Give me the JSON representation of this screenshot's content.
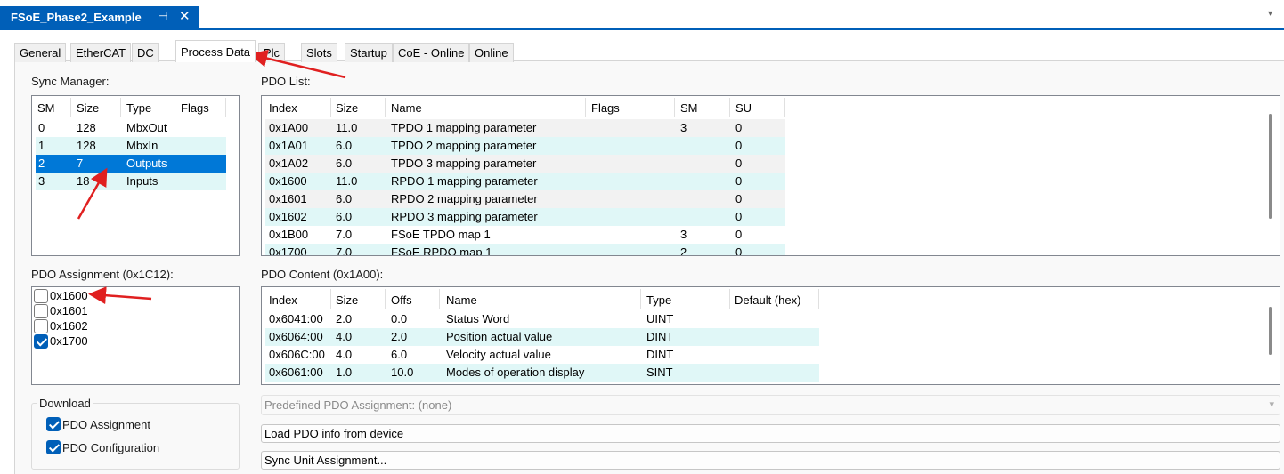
{
  "document_tab": {
    "title": "FSoE_Phase2_Example",
    "pin_glyph": "⊣",
    "close_glyph": "✕"
  },
  "tabs": [
    "General",
    "EtherCAT",
    "DC",
    "Process Data",
    "Plc",
    "Slots",
    "Startup",
    "CoE - Online",
    "Online"
  ],
  "active_tab": "Process Data",
  "sync_manager": {
    "label": "Sync Manager:",
    "columns": [
      "SM",
      "Size",
      "Type",
      "Flags"
    ],
    "rows": [
      {
        "sm": "0",
        "size": "128",
        "type": "MbxOut",
        "flags": ""
      },
      {
        "sm": "1",
        "size": "128",
        "type": "MbxIn",
        "flags": ""
      },
      {
        "sm": "2",
        "size": "7",
        "type": "Outputs",
        "flags": ""
      },
      {
        "sm": "3",
        "size": "18",
        "type": "Inputs",
        "flags": ""
      }
    ],
    "selected_index": 2
  },
  "pdo_list": {
    "label": "PDO List:",
    "columns": [
      "Index",
      "Size",
      "Name",
      "Flags",
      "SM",
      "SU"
    ],
    "rows": [
      {
        "index": "0x1A00",
        "size": "11.0",
        "name": "TPDO 1 mapping parameter",
        "flags": "",
        "sm": "3",
        "su": "0"
      },
      {
        "index": "0x1A01",
        "size": "6.0",
        "name": "TPDO 2 mapping parameter",
        "flags": "",
        "sm": "",
        "su": "0"
      },
      {
        "index": "0x1A02",
        "size": "6.0",
        "name": "TPDO 3 mapping parameter",
        "flags": "",
        "sm": "",
        "su": "0"
      },
      {
        "index": "0x1600",
        "size": "11.0",
        "name": "RPDO 1 mapping parameter",
        "flags": "",
        "sm": "",
        "su": "0"
      },
      {
        "index": "0x1601",
        "size": "6.0",
        "name": "RPDO 2 mapping parameter",
        "flags": "",
        "sm": "",
        "su": "0"
      },
      {
        "index": "0x1602",
        "size": "6.0",
        "name": "RPDO 3 mapping parameter",
        "flags": "",
        "sm": "",
        "su": "0"
      },
      {
        "index": "0x1B00",
        "size": "7.0",
        "name": "FSoE TPDO map 1",
        "flags": "",
        "sm": "3",
        "su": "0"
      },
      {
        "index": "0x1700",
        "size": "7.0",
        "name": "FSoE RPDO map 1",
        "flags": "",
        "sm": "2",
        "su": "0"
      }
    ]
  },
  "pdo_assignment": {
    "label": "PDO Assignment (0x1C12):",
    "items": [
      {
        "label": "0x1600",
        "checked": false
      },
      {
        "label": "0x1601",
        "checked": false
      },
      {
        "label": "0x1602",
        "checked": false
      },
      {
        "label": "0x1700",
        "checked": true
      }
    ]
  },
  "pdo_content": {
    "label": "PDO Content (0x1A00):",
    "columns": [
      "Index",
      "Size",
      "Offs",
      "Name",
      "Type",
      "Default (hex)"
    ],
    "rows": [
      {
        "index": "0x6041:00",
        "size": "2.0",
        "offs": "0.0",
        "name": "Status Word",
        "type": "UINT",
        "default": ""
      },
      {
        "index": "0x6064:00",
        "size": "4.0",
        "offs": "2.0",
        "name": "Position actual value",
        "type": "DINT",
        "default": ""
      },
      {
        "index": "0x606C:00",
        "size": "4.0",
        "offs": "6.0",
        "name": "Velocity actual value",
        "type": "DINT",
        "default": ""
      },
      {
        "index": "0x6061:00",
        "size": "1.0",
        "offs": "10.0",
        "name": "Modes of operation display",
        "type": "SINT",
        "default": ""
      }
    ]
  },
  "download": {
    "label": "Download",
    "pdo_assignment": {
      "label": "PDO Assignment",
      "checked": true
    },
    "pdo_configuration": {
      "label": "PDO Configuration",
      "checked": true
    }
  },
  "predefined": {
    "label": "Predefined PDO Assignment: (none)"
  },
  "buttons": {
    "load_pdo": "Load PDO info from device",
    "sync_unit": "Sync Unit Assignment..."
  },
  "colors": {
    "accent": "#005fb8",
    "row_alt": "#e0f7f7",
    "row_odd": "#f2f2f2",
    "annotation_arrow": "#e02020"
  }
}
